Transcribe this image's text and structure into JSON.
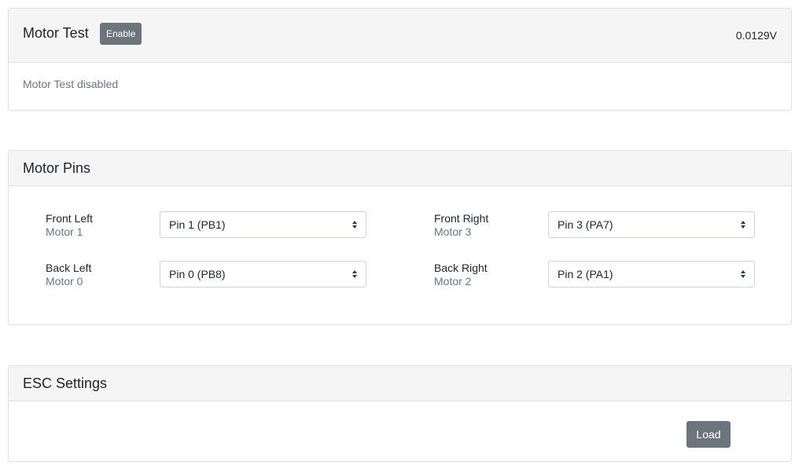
{
  "motor_test": {
    "title": "Motor Test",
    "enable_label": "Enable",
    "voltage": "0.0129V",
    "status": "Motor Test disabled"
  },
  "motor_pins": {
    "title": "Motor Pins",
    "front_left": {
      "position": "Front Left",
      "motor": "Motor 1",
      "pin": "Pin 1 (PB1)"
    },
    "front_right": {
      "position": "Front Right",
      "motor": "Motor 3",
      "pin": "Pin 3 (PA7)"
    },
    "back_left": {
      "position": "Back Left",
      "motor": "Motor 0",
      "pin": "Pin 0 (PB8)"
    },
    "back_right": {
      "position": "Back Right",
      "motor": "Motor 2",
      "pin": "Pin 2 (PA1)"
    }
  },
  "esc_settings": {
    "title": "ESC Settings",
    "load_label": "Load"
  },
  "icons": {
    "select_arrows": "chevron-up-down-icon"
  },
  "colors": {
    "secondary_button": "#6c757d",
    "header_bg": "#f5f5f5",
    "muted_text": "#6c757d"
  }
}
